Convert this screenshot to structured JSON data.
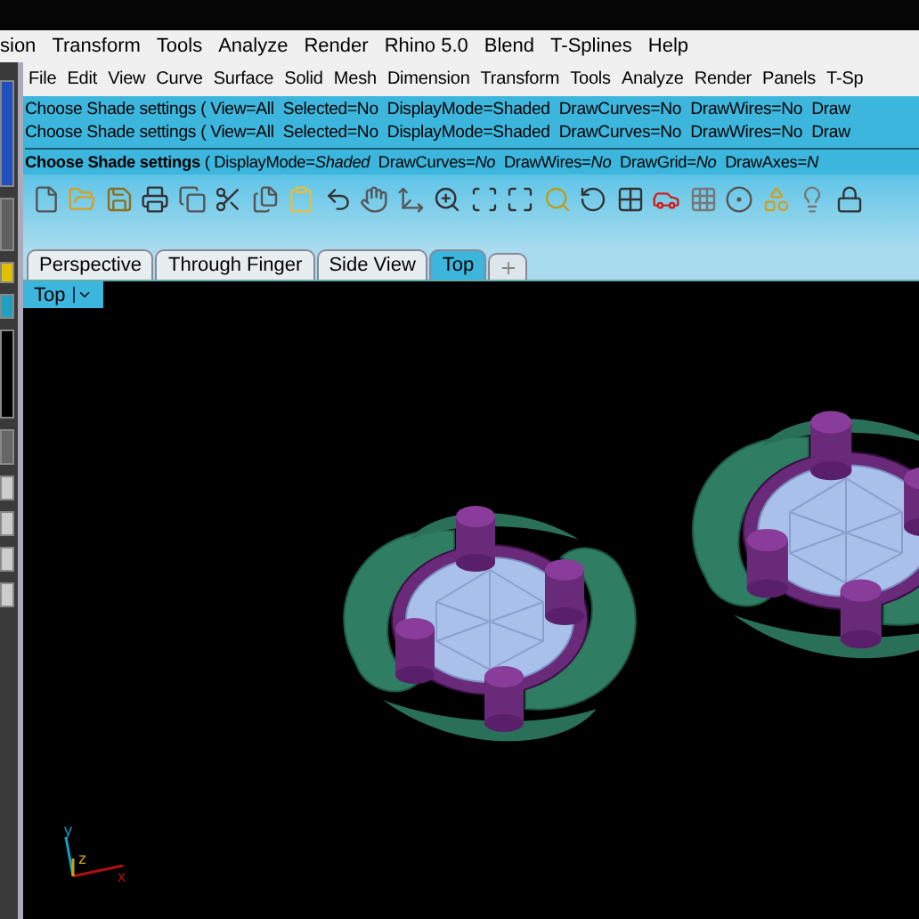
{
  "outer_menu": [
    "sion",
    "Transform",
    "Tools",
    "Analyze",
    "Render",
    "Rhino 5.0",
    "Blend",
    "T-Splines",
    "Help"
  ],
  "menu": [
    "File",
    "Edit",
    "View",
    "Curve",
    "Surface",
    "Solid",
    "Mesh",
    "Dimension",
    "Transform",
    "Tools",
    "Analyze",
    "Render",
    "Panels",
    "T-Sp"
  ],
  "command_history": [
    "Choose Shade settings ( View=All  Selected=No  DisplayMode=Shaded  DrawCurves=No  DrawWires=No  Draw",
    "Choose Shade settings ( View=All  Selected=No  DisplayMode=Shaded  DrawCurves=No  DrawWires=No  Draw"
  ],
  "command_prompt": "**Choose Shade settings** ( DisplayMode=*Shaded*  DrawCurves=*No*  DrawWires=*No*  DrawGrid=*No*  DrawAxes=*N*",
  "tabs": [
    {
      "label": "Perspective",
      "selected": false
    },
    {
      "label": "Through Finger",
      "selected": false
    },
    {
      "label": "Side View",
      "selected": false
    },
    {
      "label": "Top",
      "selected": true
    }
  ],
  "viewport": {
    "label": "Top",
    "axes": [
      "y",
      "z",
      "x"
    ]
  }
}
